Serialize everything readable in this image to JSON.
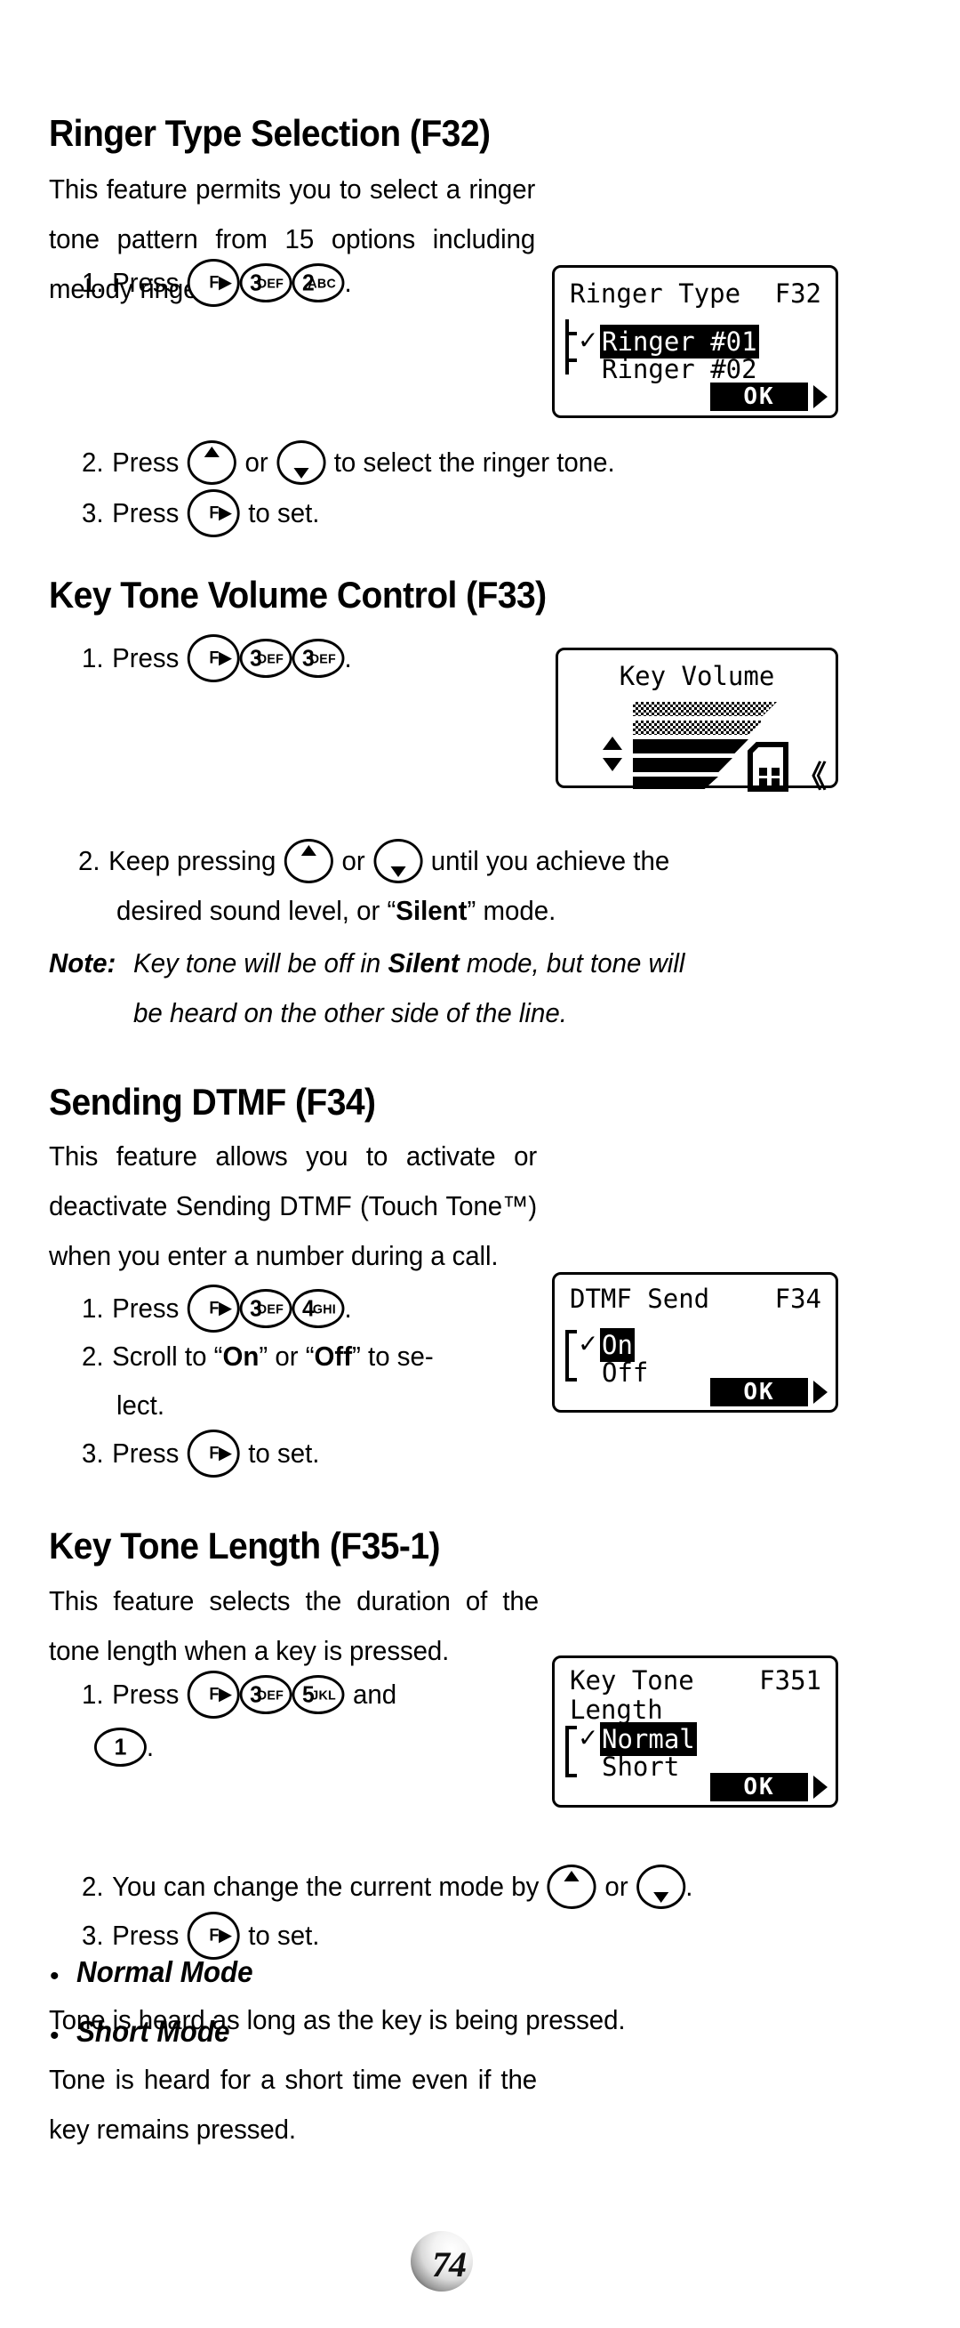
{
  "page": {
    "number": "74"
  },
  "sections": [
    {
      "id": "ringer-type",
      "heading": "Ringer Type Selection (F32)",
      "intro": "This feature permits you to select a ringer tone pattern from 15 options including melody ringers.",
      "steps": [
        {
          "num": "1.",
          "pre": "Press",
          "post": "."
        },
        {
          "num": "2.",
          "pre": "Press",
          "mid": "or",
          "post": "to select the ringer tone."
        },
        {
          "num": "3.",
          "pre": "Press",
          "post": "to set."
        }
      ],
      "keys": [
        "F",
        "3 DEF",
        "2 ABC"
      ],
      "lcd": {
        "title_left": "Ringer Type",
        "title_right": "F32",
        "options": [
          "Ringer #01",
          "Ringer #02"
        ],
        "selected_index": 0,
        "checkmark": "✓",
        "ok_label": "OK"
      }
    },
    {
      "id": "key-tone-volume",
      "heading": "Key Tone Volume Control (F33)",
      "steps": [
        {
          "num": "1.",
          "pre": "Press",
          "post": "."
        },
        {
          "num": "2.",
          "pre": "Keep pressing",
          "mid": "or",
          "post": "until you achieve the",
          "line2_a": "desired sound level, or “",
          "line2_b": "Silent",
          "line2_c": "” mode."
        }
      ],
      "keys": [
        "F",
        "3 DEF",
        "3 DEF"
      ],
      "note": {
        "label": "Note:",
        "line1_a": "Key tone will be off in ",
        "line1_b": "Silent",
        "line1_c": " mode, but tone will",
        "line2": "be heard on the other side of the line."
      },
      "lcd": {
        "title": "Key Volume",
        "bars": [
          {
            "fill": "dot"
          },
          {
            "fill": "dot"
          },
          {
            "fill": "solid"
          },
          {
            "fill": "solid"
          },
          {
            "fill": "solid"
          }
        ],
        "up_arrow": "up-triangle",
        "down_arrow": "down-triangle",
        "handset_icon": "handset-icon",
        "sound_waves": "《"
      }
    },
    {
      "id": "sending-dtmf",
      "heading": "Sending DTMF (F34)",
      "intro": "This feature allows you to activate or deactivate Sending DTMF (Touch Tone™) when you enter a number during a call.",
      "steps": [
        {
          "num": "1.",
          "pre": "Press",
          "post": "."
        },
        {
          "num": "2.",
          "pre": "Scroll to “",
          "b1": "On",
          "mid": "” or “",
          "b2": "Off",
          "post": "” to se-",
          "line2": "lect."
        },
        {
          "num": "3.",
          "pre": "Press",
          "post": "to set."
        }
      ],
      "keys": [
        "F",
        "3 DEF",
        "4 GHI"
      ],
      "lcd": {
        "title_left": "DTMF Send",
        "title_right": "F34",
        "options": [
          "On",
          "Off"
        ],
        "selected_index": 0,
        "checkmark": "✓",
        "ok_label": "OK"
      }
    },
    {
      "id": "key-tone-length",
      "heading": "Key Tone Length (F35-1)",
      "intro": "This feature selects the duration of the tone length when a key is pressed.",
      "steps": [
        {
          "num": "1.",
          "pre": "Press",
          "mid": "and",
          "post": "."
        },
        {
          "num": "2.",
          "pre": "You can change the current mode by",
          "mid": "or",
          "post": "."
        },
        {
          "num": "3.",
          "pre": "Press",
          "post": "to set."
        }
      ],
      "keys": [
        "F",
        "3 DEF",
        "5 JKL",
        "1"
      ],
      "lcd": {
        "title_left": "Key Tone",
        "title_right": "F351",
        "title_line2": "Length",
        "options": [
          "Normal",
          "Short"
        ],
        "selected_index": 0,
        "checkmark": "✓",
        "ok_label": "OK"
      },
      "modes": [
        {
          "bullet": "•",
          "title": "Normal Mode",
          "text": "Tone is heard as long as the key is being pressed."
        },
        {
          "bullet": "•",
          "title": "Short Mode",
          "text": "Tone is heard for a short time even if the key remains pressed."
        }
      ]
    }
  ],
  "keycaps": {
    "f": {
      "label": "F",
      "arrow": "▶"
    },
    "k3": {
      "digit": "3",
      "letters": "DEF"
    },
    "k2": {
      "digit": "2",
      "letters": "ABC"
    },
    "k4": {
      "digit": "4",
      "letters": "GHI"
    },
    "k5": {
      "digit": "5",
      "letters": "JKL"
    },
    "k1": {
      "digit": "1"
    },
    "up": {
      "name": "up-arrow-key"
    },
    "down": {
      "name": "down-arrow-key"
    }
  }
}
